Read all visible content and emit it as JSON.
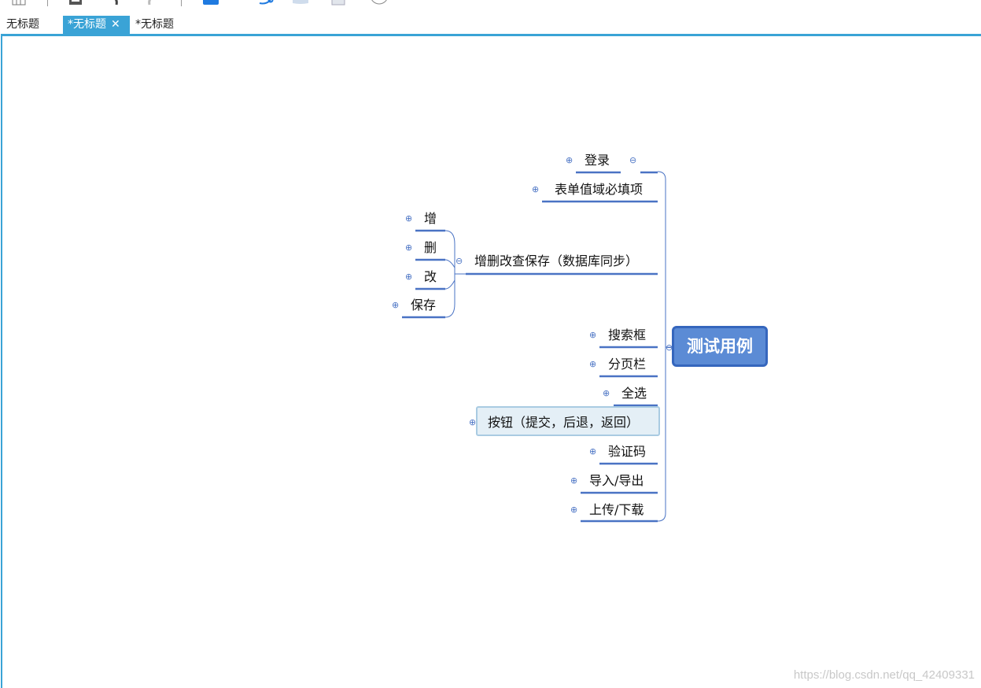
{
  "toolbar": {
    "icons": [
      "view-icon",
      "save-icon",
      "undo-icon",
      "redo-icon",
      "topic-icon",
      "relationship-icon",
      "callout-icon",
      "note-icon",
      "circle-icon"
    ]
  },
  "tabs": [
    {
      "label": "无标题",
      "active": false
    },
    {
      "label": "*无标题",
      "active": true,
      "close": "✕"
    },
    {
      "label": "*无标题",
      "active": false
    }
  ],
  "mindmap": {
    "central": "测试用例",
    "topics": {
      "login": "登录",
      "form": "表单值域必填项",
      "crud": "增删改查保存（数据库同步）",
      "crud_children": [
        "增",
        "删",
        "改",
        "保存"
      ],
      "search": "搜索框",
      "paging": "分页栏",
      "select_all": "全选",
      "buttons": "按钮（提交，后退，返回）",
      "captcha": "验证码",
      "import_export": "导入/导出",
      "upload_download": "上传/下载"
    },
    "expand_symbol": "⊕",
    "collapse_symbol": "⊖"
  },
  "colors": {
    "accent": "#3aa3d6",
    "line": "#4a73c4",
    "central_fill": "#5b8bd5"
  },
  "watermark": "https://blog.csdn.net/qq_42409331"
}
